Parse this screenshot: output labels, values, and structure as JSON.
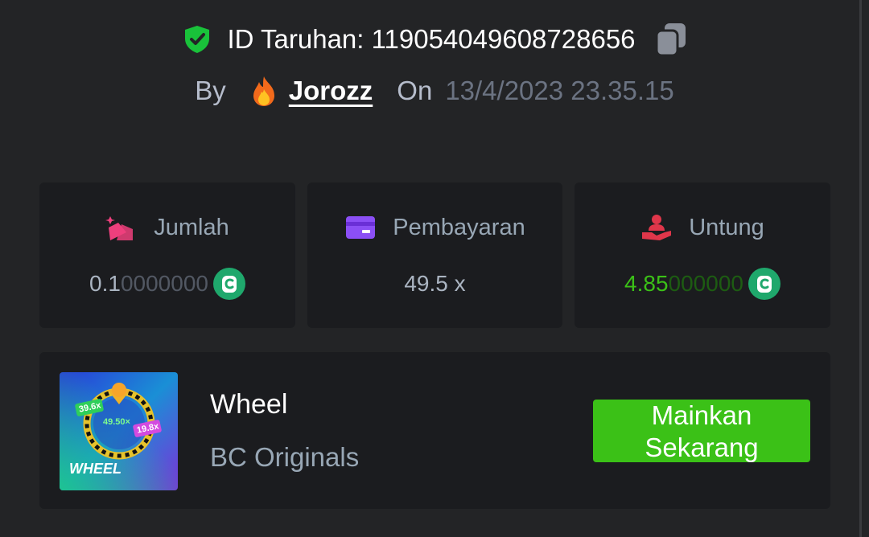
{
  "header": {
    "bet_id_label": "ID Taruhan: 119054049608728656",
    "by_label": "By",
    "username": "Jorozz",
    "on_label": "On",
    "datetime": "13/4/2023 23.35.15"
  },
  "stats": {
    "amount": {
      "label": "Jumlah",
      "value_main": "0.1",
      "value_dim": "0000000",
      "icon": "coin-bc-icon"
    },
    "payout": {
      "label": "Pembayaran",
      "value": "49.5 x"
    },
    "profit": {
      "label": "Untung",
      "value_main": "4.85",
      "value_dim": "000000",
      "icon": "coin-bc-icon"
    }
  },
  "game": {
    "title": "Wheel",
    "provider": "BC Originals",
    "play_label": "Mainkan Sekarang",
    "thumb_text": {
      "name": "WHEEL",
      "center": "49.50×",
      "left": "39.6x",
      "right": "19.8x"
    }
  },
  "colors": {
    "background": "#232426",
    "card": "#1b1c1f",
    "accent_green": "#3bc117",
    "profit_green": "#3bc117",
    "shield_green": "#19c23a",
    "amount_pink": "#ee3f7d",
    "payout_purple": "#8b4ff5",
    "profit_red": "#e0364a"
  }
}
